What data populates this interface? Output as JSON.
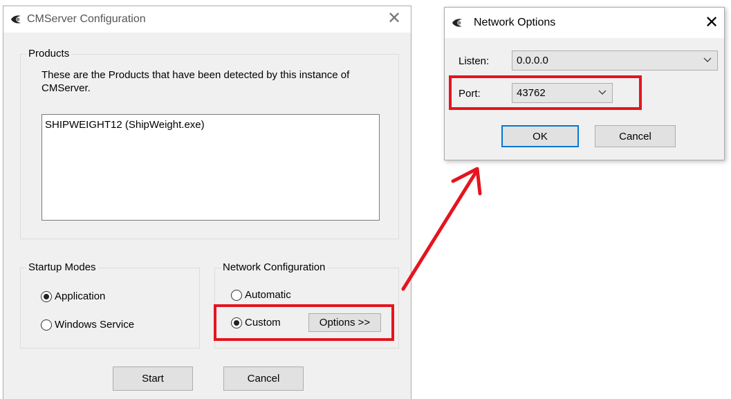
{
  "main_window": {
    "title": "CMServer Configuration",
    "products": {
      "legend": "Products",
      "description": "These are the Products that have been detected by this instance of CMServer.",
      "items": [
        "SHIPWEIGHT12 (ShipWeight.exe)"
      ]
    },
    "startup_modes": {
      "legend": "Startup Modes",
      "application_label": "Application",
      "windows_service_label": "Windows Service",
      "selected": "Application"
    },
    "network_configuration": {
      "legend": "Network Configuration",
      "automatic_label": "Automatic",
      "custom_label": "Custom",
      "options_button": "Options >>",
      "selected": "Custom"
    },
    "start_button": "Start",
    "cancel_button": "Cancel"
  },
  "network_options": {
    "title": "Network Options",
    "listen_label": "Listen:",
    "listen_value": "0.0.0.0",
    "port_label": "Port:",
    "port_value": "43762",
    "ok_button": "OK",
    "cancel_button": "Cancel"
  },
  "colors": {
    "highlight": "#e5141e",
    "focus_border": "#0078d7",
    "dialog_bg": "#f0f0f0"
  },
  "icons": {
    "app": "eye-icon",
    "close": "close-icon",
    "dropdown": "chevron-down-icon"
  }
}
